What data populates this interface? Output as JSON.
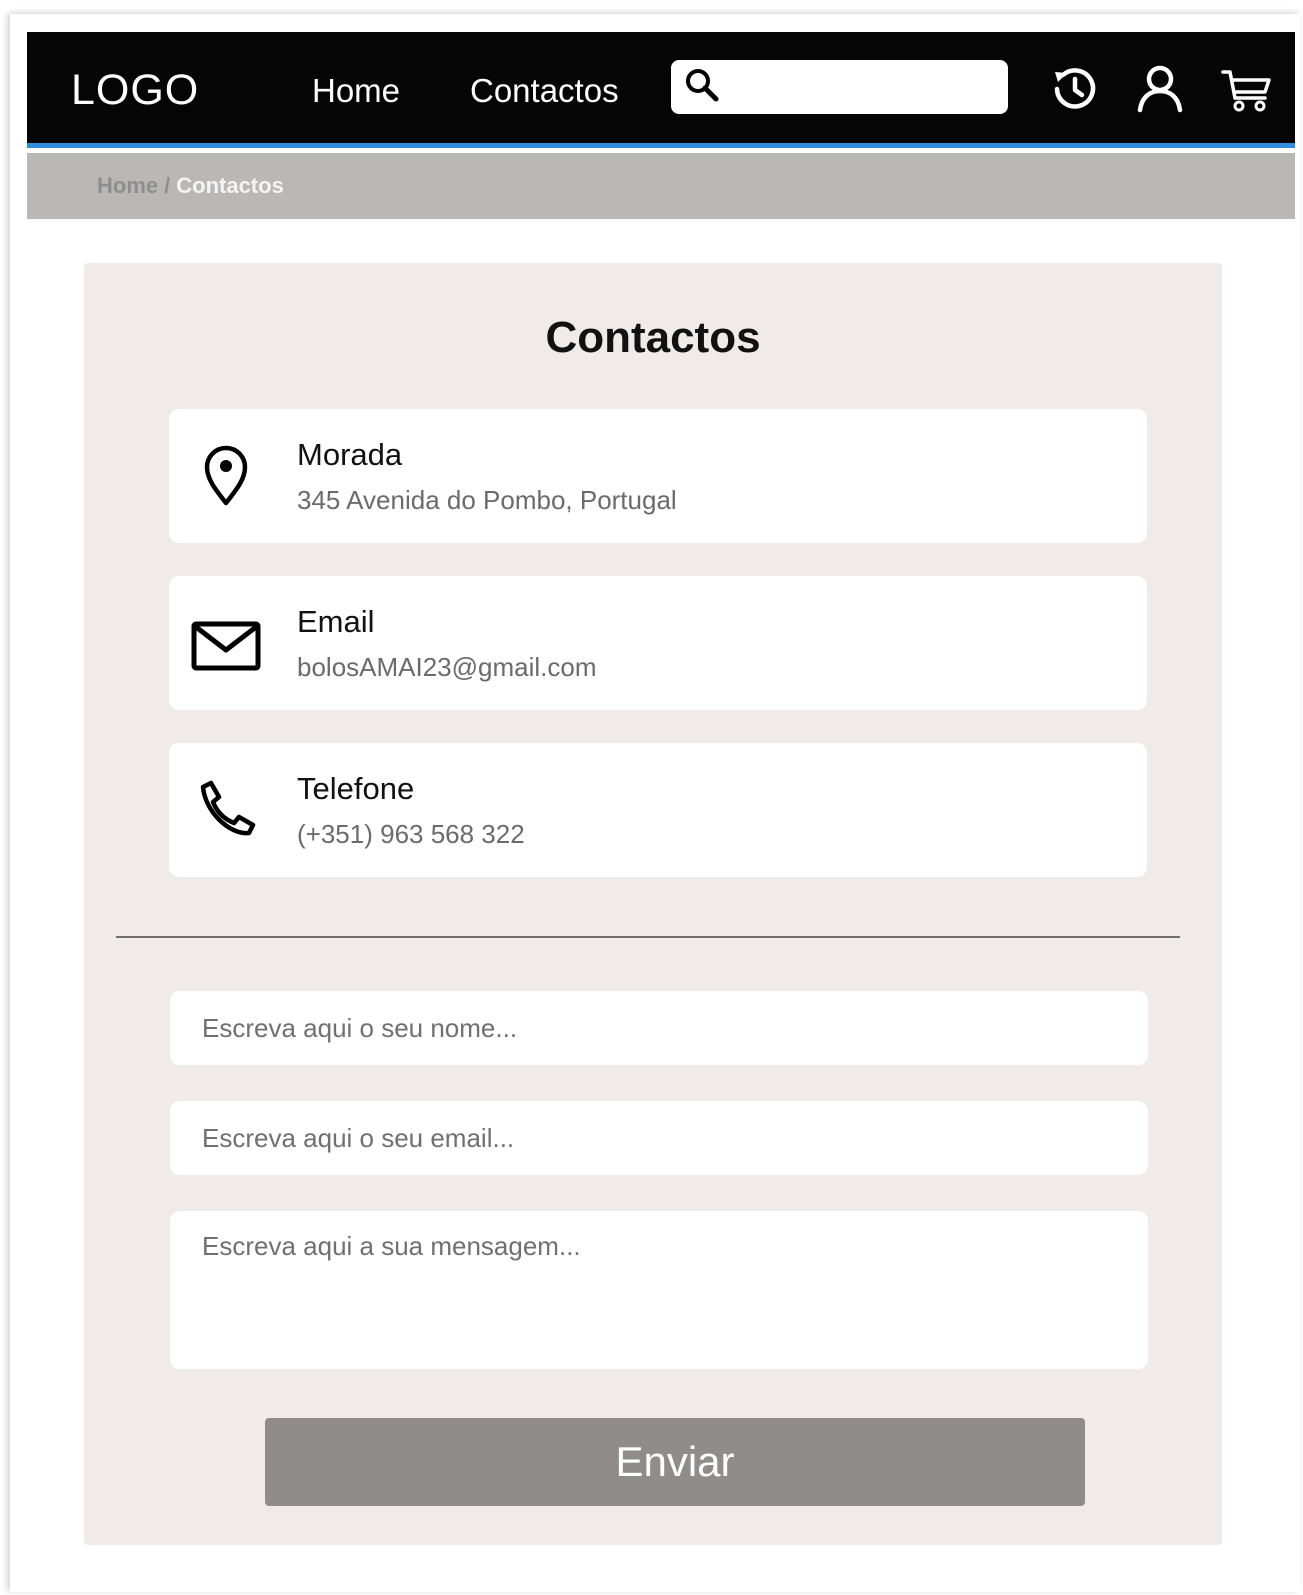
{
  "header": {
    "logo": "LOGO",
    "nav": [
      {
        "label": "Home"
      },
      {
        "label": "Contactos"
      }
    ],
    "search": {
      "placeholder": "",
      "value": ""
    },
    "icons": [
      "history-icon",
      "user-icon",
      "cart-icon"
    ],
    "accent_color": "#2f8de0"
  },
  "breadcrumb": {
    "home": "Home",
    "separator": "/",
    "current": "Contactos"
  },
  "contacts": {
    "title": "Contactos",
    "cards": [
      {
        "icon": "map-pin-icon",
        "label": "Morada",
        "value": "345 Avenida do Pombo, Portugal"
      },
      {
        "icon": "mail-icon",
        "label": "Email",
        "value": "bolosAMAI23@gmail.com"
      },
      {
        "icon": "phone-icon",
        "label": "Telefone",
        "value": "(+351) 963 568 322"
      }
    ]
  },
  "form": {
    "name_placeholder": "Escreva aqui o seu nome...",
    "email_placeholder": "Escreva aqui o seu email...",
    "message_placeholder": "Escreva aqui a sua mensagem...",
    "submit_label": "Enviar",
    "submit_color": "#918c8c"
  }
}
